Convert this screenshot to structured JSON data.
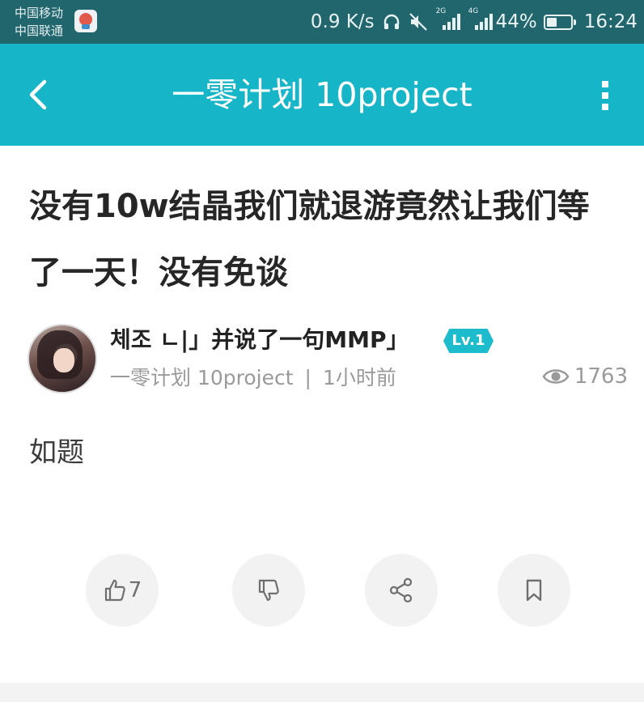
{
  "status_bar": {
    "carrier_1": "中国移动",
    "carrier_2": "中国联通",
    "speed": "0.9 K/s",
    "signal_1_label": "2G",
    "signal_2_label": "4G",
    "battery": "44%",
    "battery_level": 0.44,
    "time": "16:24"
  },
  "header": {
    "title": "一零计划 10project"
  },
  "post": {
    "title": "没有10w结晶我们就退游竟然让我们等了一天！没有免谈",
    "author": "체조 ㄴ|」并说了一句MMP」",
    "level": "Lv.1",
    "group": "一零计划 10project",
    "separator": "|",
    "time_ago": "1小时前",
    "views": "1763",
    "body": "如题"
  },
  "actions": {
    "like_count": "7"
  },
  "colors": {
    "status_bar": "#21666d",
    "header": "#17b5c8",
    "badge": "#1cbccc"
  }
}
